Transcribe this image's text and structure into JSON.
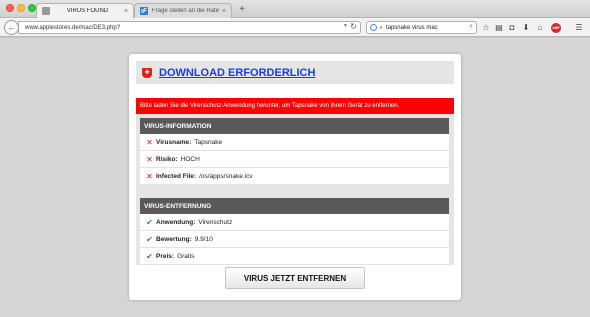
{
  "browser": {
    "tabs": [
      {
        "title": "VIRUS FOUND",
        "close": "×",
        "active": true
      },
      {
        "title": "Frage stellen an die Rateg...",
        "close": "×",
        "active": false,
        "favicon_text": "gF"
      }
    ],
    "new_tab": "+",
    "back": "←",
    "url": "www.applestores.de/mac/DE3.php?",
    "reload": "↻",
    "search_query": "tapsnake virus mac",
    "toolbar_icons": [
      "star-icon",
      "reader-icon",
      "pocket-icon",
      "download-icon",
      "home-icon",
      "adblock-icon",
      "menu-icon"
    ],
    "adblock_label": "ABP"
  },
  "page": {
    "title": "DOWNLOAD ERFORDERLICH",
    "alert": "Bitte laden Sie die Virenschutz-Anwendung herunter, um Tapsnake von Ihrem Gerät zu entfernen.",
    "virus_info": {
      "heading": "VIRUS-INFORMATION",
      "rows": [
        {
          "label": "Virusname:",
          "value": "Tapsnake"
        },
        {
          "label": "Risiko:",
          "value": "HOCH"
        },
        {
          "label": "Infected File:",
          "value": "/os/apps/snake.icv"
        }
      ]
    },
    "removal": {
      "heading": "VIRUS-ENTFERNUNG",
      "rows": [
        {
          "label": "Anwendung:",
          "value": "Virenschutz"
        },
        {
          "label": "Bewertung:",
          "value": "9.9/10"
        },
        {
          "label": "Preis:",
          "value": "Gratis"
        }
      ]
    },
    "button": "VIRUS JETZT ENTFERNEN"
  },
  "colors": {
    "link_blue": "#1a3ee0",
    "alert_red": "#ff0000",
    "section_gray": "#595959",
    "cross_red": "#c91c1c",
    "check_green": "#2c9a2c"
  }
}
